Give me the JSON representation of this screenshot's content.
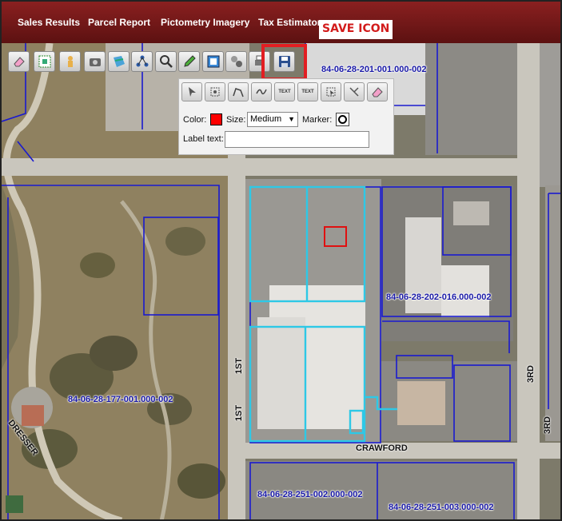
{
  "nav": {
    "items": [
      "Sales Results",
      "Parcel Report",
      "Pictometry Imagery",
      "Tax Estimator"
    ]
  },
  "annotation": {
    "save_label": "SAVE ICON",
    "highlight_color": "#e21e22"
  },
  "toolbar": {
    "tools": [
      "eraser-icon",
      "select-grid-icon",
      "person-icon",
      "camera-icon",
      "layers-icon",
      "network-icon",
      "zoom-icon",
      "pencil-icon",
      "map-frame-icon",
      "buffer-icon",
      "print-icon",
      "save-icon"
    ]
  },
  "draw_panel": {
    "tools": [
      "pointer-icon",
      "point-icon",
      "polyline-icon",
      "freehand-icon",
      "text-icon",
      "label-text-icon",
      "edit-shape-icon",
      "move-icon",
      "eraser-icon"
    ],
    "text_tool_label": "TEXT",
    "color_label": "Color:",
    "color_value": "#ff0000",
    "size_label": "Size:",
    "size_value": "Medium",
    "marker_label": "Marker:",
    "label_text_label": "Label text:",
    "label_text_value": ""
  },
  "map": {
    "parcels": [
      "84-06-28-201-001.000-002",
      "84-06-28-202-016.000-002",
      "84-06-28-177-001.000-002",
      "84-06-28-251-002.000-002",
      "84-06-28-251-003.000-002"
    ],
    "streets": [
      "1ST",
      "3RD",
      "3RD",
      "CRAWFORD",
      "DRESSER"
    ]
  }
}
